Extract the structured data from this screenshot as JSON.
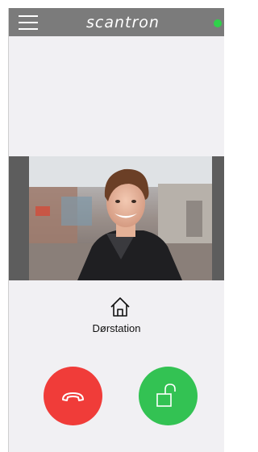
{
  "header": {
    "brand": "scantron",
    "menu_icon": "hamburger-menu-icon",
    "status_color": "#2fd24a"
  },
  "video": {
    "content": "video-feed"
  },
  "station": {
    "icon": "home-icon",
    "label": "Dørstation"
  },
  "actions": {
    "decline": {
      "icon": "hang-up-icon",
      "color": "#f03c39"
    },
    "unlock": {
      "icon": "unlock-icon",
      "color": "#33c253"
    }
  }
}
